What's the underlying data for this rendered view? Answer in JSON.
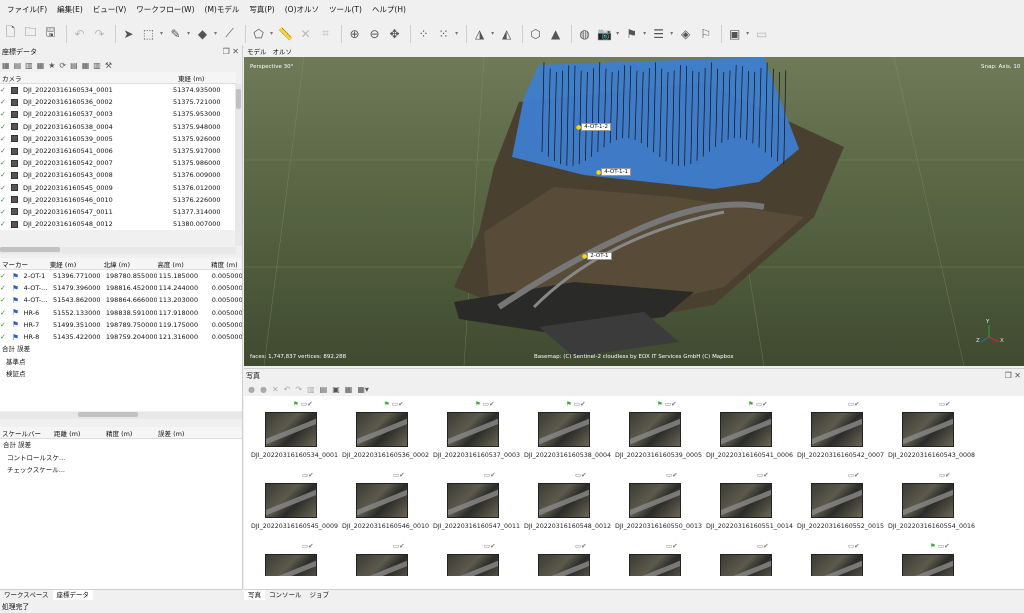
{
  "menu": [
    "ファイル(F)",
    "編集(E)",
    "ビュー(V)",
    "ワークフロー(W)",
    "(M)モデル",
    "写真(P)",
    "(O)オルソ",
    "ツール(T)",
    "ヘルプ(H)"
  ],
  "toolbar_icons": [
    "new-icon",
    "open-icon",
    "save-icon",
    "undo-icon",
    "redo-icon",
    "select-icon",
    "rect-select-icon",
    "paint-icon",
    "shape-icon",
    "line-icon",
    "polygon-icon",
    "ruler-icon",
    "cross-icon",
    "crop-icon",
    "zoom-in-icon",
    "zoom-out-icon",
    "move-icon",
    "points-icon",
    "dots-icon",
    "model-icon",
    "texture-icon",
    "tiles-icon",
    "dem-icon",
    "globe-icon",
    "camera-icon",
    "marker-icon",
    "menu-icon",
    "shape-flag-icon",
    "flag-icon",
    "image-icon",
    "rect-icon"
  ],
  "reference_panel": {
    "title": "座標データ",
    "camera_columns": [
      "カメラ",
      "東経 (m)"
    ],
    "cameras": [
      {
        "name": "DJI_20220316160534_0001",
        "east": "51374.935000"
      },
      {
        "name": "DJI_20220316160536_0002",
        "east": "51375.721000"
      },
      {
        "name": "DJI_20220316160537_0003",
        "east": "51375.953000"
      },
      {
        "name": "DJI_20220316160538_0004",
        "east": "51375.948000"
      },
      {
        "name": "DJI_20220316160539_0005",
        "east": "51375.926000"
      },
      {
        "name": "DJI_20220316160541_0006",
        "east": "51375.917000"
      },
      {
        "name": "DJI_20220316160542_0007",
        "east": "51375.986000"
      },
      {
        "name": "DJI_20220316160543_0008",
        "east": "51376.009000"
      },
      {
        "name": "DJI_20220316160545_0009",
        "east": "51376.012000"
      },
      {
        "name": "DJI_20220316160546_0010",
        "east": "51376.226000"
      },
      {
        "name": "DJI_20220316160547_0011",
        "east": "51377.314000"
      },
      {
        "name": "DJI_20220316160548_0012",
        "east": "51380.007000"
      }
    ],
    "marker_columns": [
      "マーカー",
      "東経 (m)",
      "北緯 (m)",
      "高度 (m)",
      "精度 (m)"
    ],
    "markers": [
      {
        "name": "2-OT-1",
        "east": "51396.771000",
        "north": "198780.855000",
        "alt": "115.185000",
        "acc": "0.005000"
      },
      {
        "name": "4-OT-...",
        "east": "51479.396000",
        "north": "198816.452000",
        "alt": "114.244000",
        "acc": "0.005000"
      },
      {
        "name": "4-OT-...",
        "east": "51543.862000",
        "north": "198864.666000",
        "alt": "113.203000",
        "acc": "0.005000"
      },
      {
        "name": "HR-6",
        "east": "51552.133000",
        "north": "198838.591000",
        "alt": "117.918000",
        "acc": "0.005000"
      },
      {
        "name": "HR-7",
        "east": "51499.351000",
        "north": "198789.750000",
        "alt": "119.175000",
        "acc": "0.005000"
      },
      {
        "name": "HR-8",
        "east": "51435.422000",
        "north": "198759.204000",
        "alt": "121.316000",
        "acc": "0.005000"
      }
    ],
    "marker_tree": [
      "合計 誤差",
      "基準点",
      "検証点"
    ],
    "scalebar_columns": [
      "スケールバー",
      "距離 (m)",
      "精度 (m)",
      "誤差 (m)"
    ],
    "scalebar_tree": [
      "合計 誤差",
      "コントロールスケ...",
      "チェックスケール..."
    ],
    "tabs": [
      "ワークスペース",
      "座標データ"
    ]
  },
  "model_view": {
    "tabs": [
      "モデル",
      "オルソ"
    ],
    "perspective": "Perspective 30°",
    "snap": "Snap: Axis, 10",
    "stats": "faces: 1,747,837 vertices: 892,288",
    "attribution": "Basemap: (C) Sentinel-2 cloudless by EOX IT Services GmbH (C) Mapbox",
    "markers": [
      "4-OT-1-2",
      "4-OT-1-1",
      "2-OT-1"
    ],
    "axis": [
      "Y",
      "Z",
      "X"
    ]
  },
  "photos_panel": {
    "title": "写真",
    "photos": [
      {
        "name": "DJI_20220316160534_0001",
        "flag": true
      },
      {
        "name": "DJI_20220316160536_0002",
        "flag": true
      },
      {
        "name": "DJI_20220316160537_0003",
        "flag": true
      },
      {
        "name": "DJI_20220316160538_0004",
        "flag": true
      },
      {
        "name": "DJI_20220316160539_0005",
        "flag": true
      },
      {
        "name": "DJI_20220316160541_0006",
        "flag": true
      },
      {
        "name": "DJI_20220316160542_0007",
        "flag": false
      },
      {
        "name": "DJI_20220316160543_0008",
        "flag": false
      },
      {
        "name": "DJI_20220316160545_0009",
        "flag": false
      },
      {
        "name": "DJI_20220316160546_0010",
        "flag": false
      },
      {
        "name": "DJI_20220316160547_0011",
        "flag": false
      },
      {
        "name": "DJI_20220316160548_0012",
        "flag": false
      },
      {
        "name": "DJI_20220316160550_0013",
        "flag": false
      },
      {
        "name": "DJI_20220316160551_0014",
        "flag": false
      },
      {
        "name": "DJI_20220316160552_0015",
        "flag": false
      },
      {
        "name": "DJI_20220316160554_0016",
        "flag": false
      },
      {
        "name": "",
        "flag": false
      },
      {
        "name": "",
        "flag": false
      },
      {
        "name": "",
        "flag": false
      },
      {
        "name": "",
        "flag": false
      },
      {
        "name": "",
        "flag": false
      },
      {
        "name": "",
        "flag": false
      },
      {
        "name": "",
        "flag": false
      },
      {
        "name": "",
        "flag": true
      }
    ],
    "bottom_tabs": [
      "写真",
      "コンソール",
      "ジョブ"
    ]
  },
  "status": "処理完了"
}
